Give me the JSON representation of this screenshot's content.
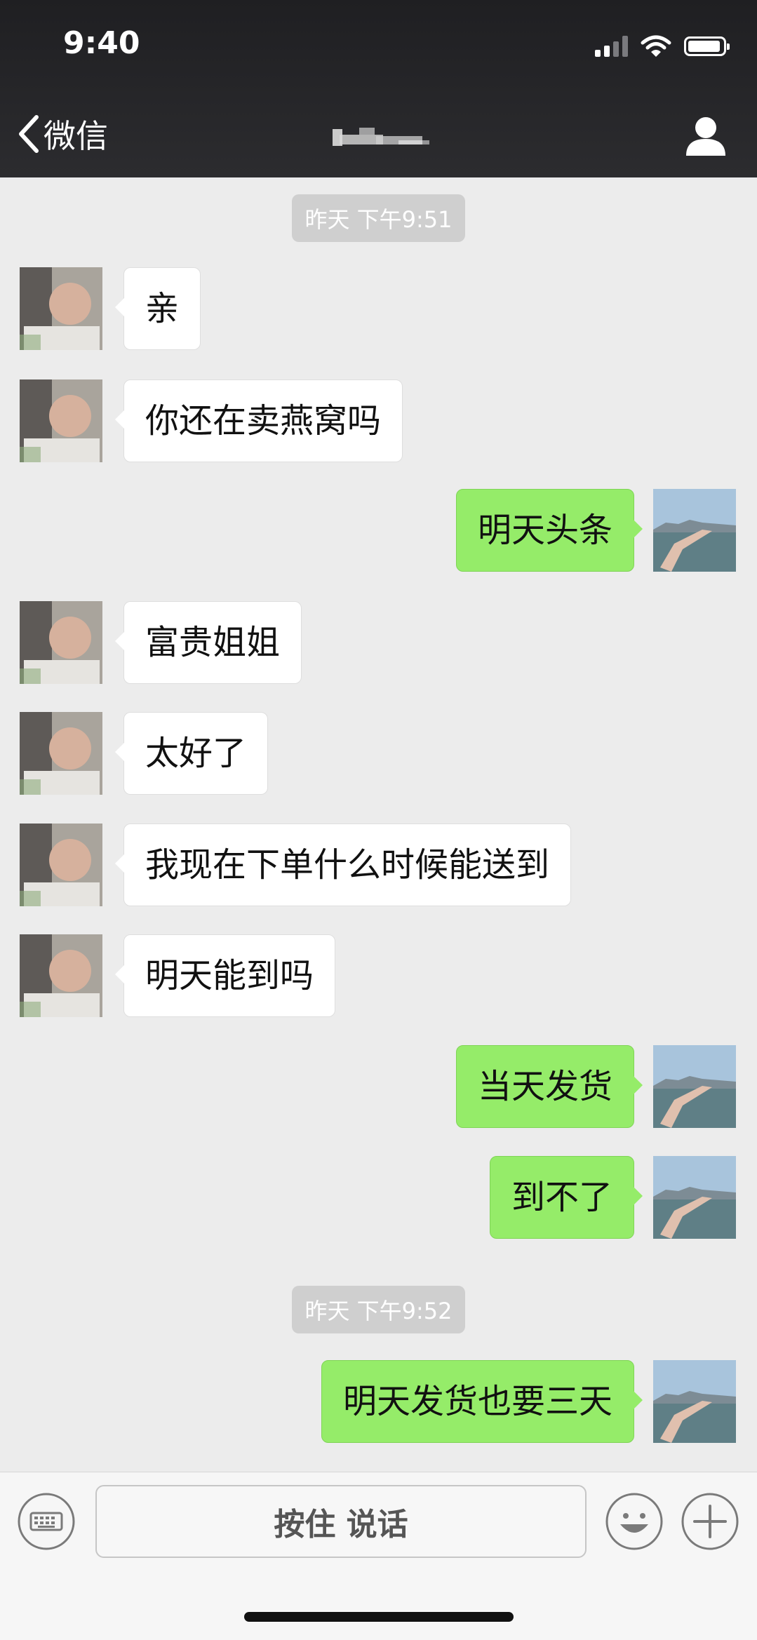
{
  "status_bar": {
    "time": "9:40"
  },
  "nav": {
    "back_label": "微信"
  },
  "messages": [
    {
      "kind": "timestamp",
      "text": "昨天 下午9:51"
    },
    {
      "kind": "incoming",
      "text": "亲"
    },
    {
      "kind": "incoming",
      "text": "你还在卖燕窝吗"
    },
    {
      "kind": "outgoing",
      "text": "明天头条"
    },
    {
      "kind": "incoming",
      "text": "富贵姐姐"
    },
    {
      "kind": "incoming",
      "text": "太好了"
    },
    {
      "kind": "incoming",
      "text": "我现在下单什么时候能送到"
    },
    {
      "kind": "incoming",
      "text": "明天能到吗"
    },
    {
      "kind": "outgoing",
      "text": "当天发货"
    },
    {
      "kind": "outgoing",
      "text": "到不了"
    },
    {
      "kind": "timestamp",
      "text": "昨天 下午9:52"
    },
    {
      "kind": "outgoing",
      "text": "明天发货也要三天"
    }
  ],
  "input_bar": {
    "voice_label": "按住 说话"
  },
  "colors": {
    "topbar": "#2a2a2d",
    "chat_background": "#ececec",
    "outgoing_bubble": "#95ec69",
    "incoming_bubble": "#ffffff"
  },
  "icons": {
    "back": "chevron-left-icon",
    "profile": "person-icon",
    "keyboard": "keyboard-icon",
    "emoji": "emoji-icon",
    "plus": "plus-icon"
  }
}
